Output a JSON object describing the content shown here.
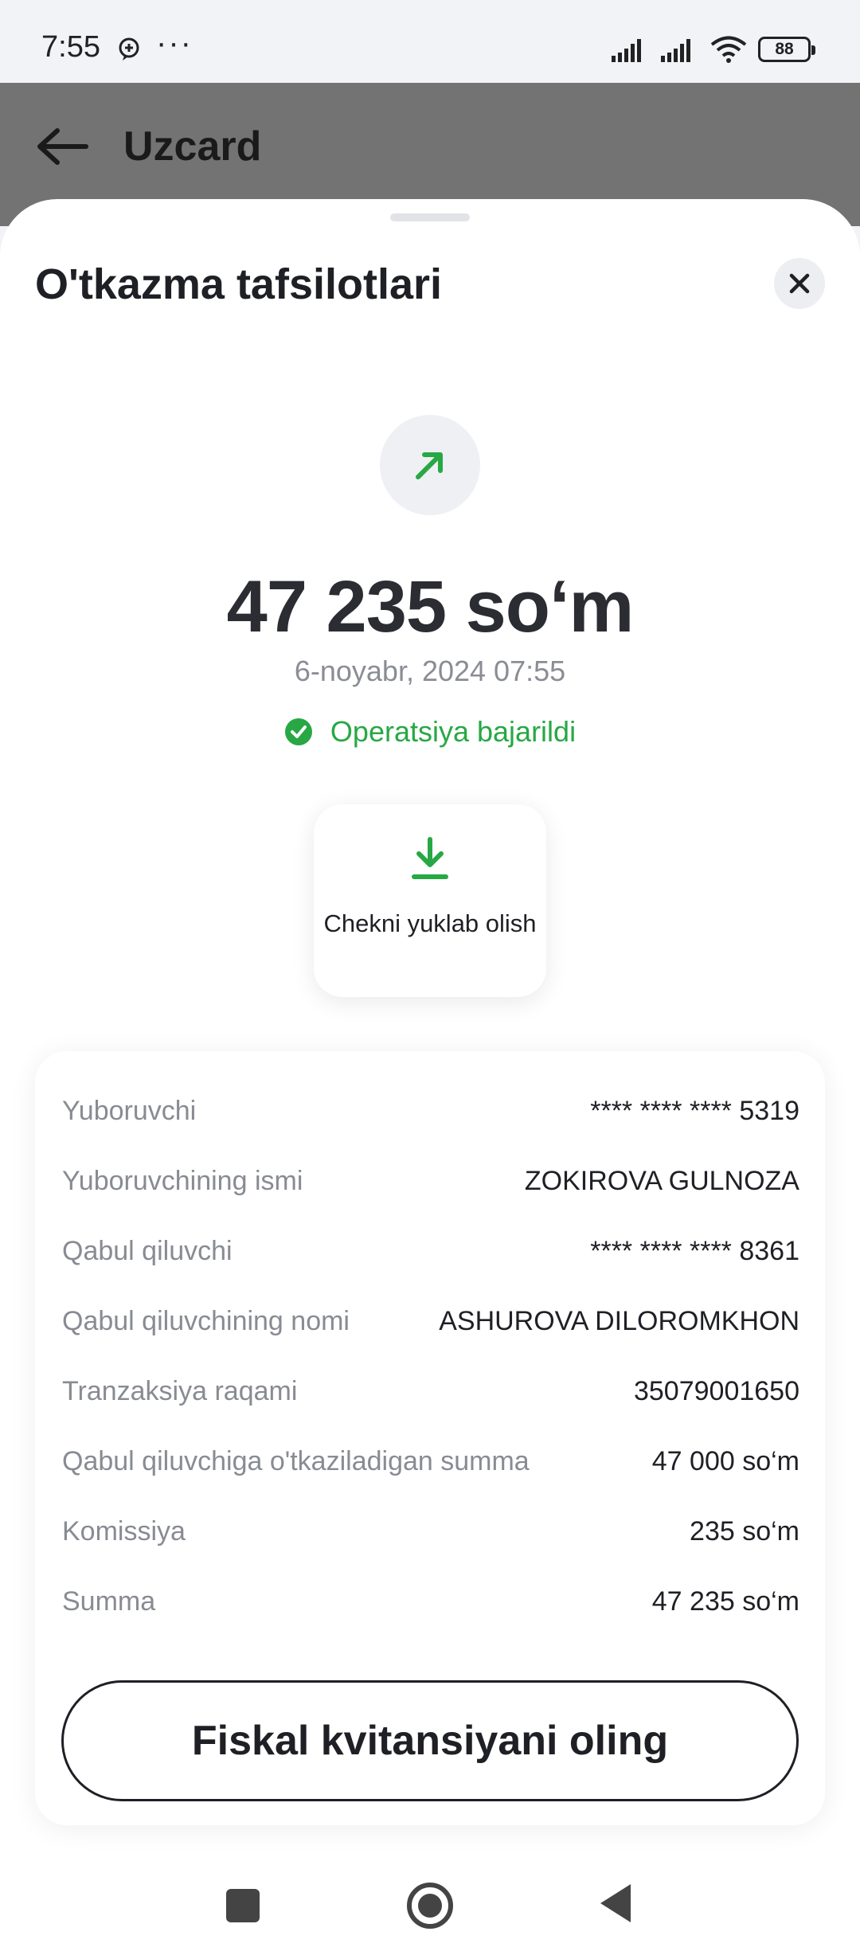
{
  "status_bar": {
    "time": "7:55",
    "battery": "88",
    "icons": [
      "message-icon",
      "more-dots-icon",
      "signal-icon",
      "signal-icon",
      "wifi-icon",
      "battery-icon"
    ]
  },
  "app_bar": {
    "title": "Uzcard"
  },
  "sheet": {
    "title": "O'tkazma tafsilotlari",
    "amount": "47 235 so‘m",
    "date": "6-noyabr, 2024 07:55",
    "status": "Operatsiya bajarildi",
    "status_color": "#27a844",
    "download_receipt": "Chekni yuklab olish"
  },
  "details": [
    {
      "label": "Yuboruvchi",
      "value": "**** **** **** 5319"
    },
    {
      "label": "Yuboruvchining ismi",
      "value": "ZOKIROVA GULNOZA"
    },
    {
      "label": "Qabul qiluvchi",
      "value": "**** **** **** 8361"
    },
    {
      "label": "Qabul qiluvchining nomi",
      "value": "ASHUROVA DILOROMKHON"
    },
    {
      "label": "Tranzaksiya raqami",
      "value": "35079001650"
    },
    {
      "label": "Qabul qiluvchiga o'tkaziladigan summa",
      "value": "47 000 so‘m"
    },
    {
      "label": "Komissiya",
      "value": "235 so‘m"
    },
    {
      "label": "Summa",
      "value": "47 235 so‘m"
    }
  ],
  "fiscal_button": "Fiskal kvitansiyani oling"
}
